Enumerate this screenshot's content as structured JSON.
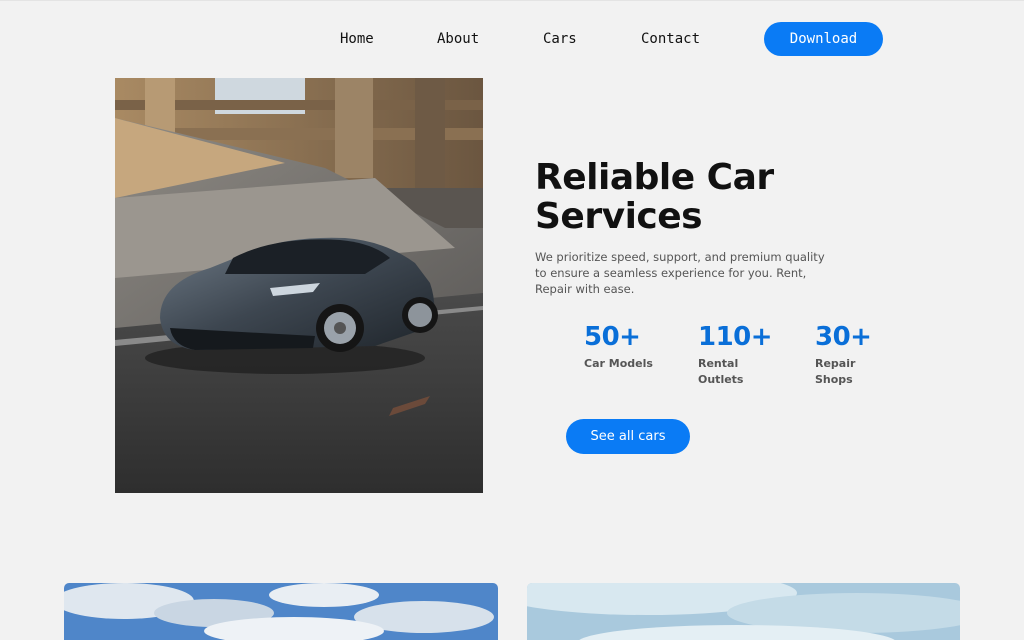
{
  "nav": {
    "links": [
      "Home",
      "About",
      "Cars",
      "Contact"
    ],
    "download_label": "Download"
  },
  "hero": {
    "title": "Reliable Car Services",
    "description": "We prioritize speed, support, and premium quality to ensure a seamless experience for you. Rent, Repair with ease.",
    "stats": [
      {
        "value": "50+",
        "label": "Car Models"
      },
      {
        "value": "110+",
        "label": "Rental Outlets"
      },
      {
        "value": "30+",
        "label": "Repair Shops"
      }
    ],
    "cta_label": "See all cars"
  },
  "colors": {
    "accent": "#0a7bf5",
    "stat_number": "#0a6fd8",
    "background": "#f2f2f2"
  }
}
